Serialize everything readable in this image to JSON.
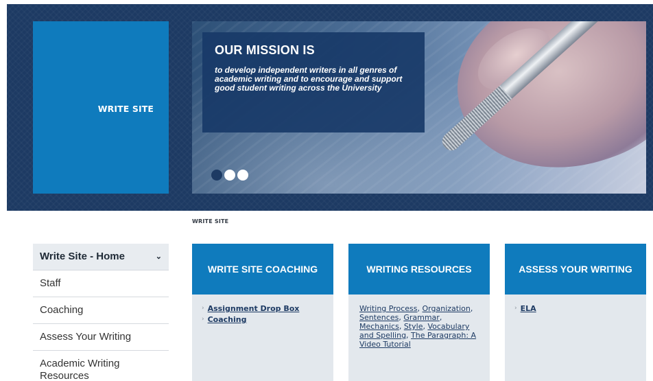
{
  "banner": {
    "site_tile_label": "WRITE SITE",
    "mission_title": "OUR MISSION IS",
    "mission_text": "to develop independent writers in all genres of academic writing and to encourage and support good student writing across the University",
    "slider_dot_count": 3,
    "active_dot_index": 0
  },
  "breadcrumb": "WRITE SITE",
  "sidebar": {
    "items": [
      {
        "label": "Write Site - Home",
        "expanded": true
      },
      {
        "label": "Staff"
      },
      {
        "label": "Coaching"
      },
      {
        "label": "Assess Your Writing"
      },
      {
        "label": "Academic Writing Resources"
      }
    ]
  },
  "cards": {
    "coaching": {
      "title": "WRITE SITE COACHING",
      "links": [
        "Assignment Drop Box",
        "Coaching"
      ]
    },
    "resources": {
      "title": "WRITING RESOURCES",
      "links": [
        "Writing Process",
        "Organization",
        "Sentences",
        "Grammar",
        "Mechanics",
        "Style",
        "Vocabulary and Spelling",
        "The Paragraph: A Video Tutorial"
      ]
    },
    "assess": {
      "title": "ASSESS YOUR WRITING",
      "links": [
        "ELA"
      ]
    }
  },
  "colors": {
    "banner_bg": "#1d3a63",
    "accent_blue": "#0f7bbd",
    "card_body_bg": "#e3e8ed"
  }
}
